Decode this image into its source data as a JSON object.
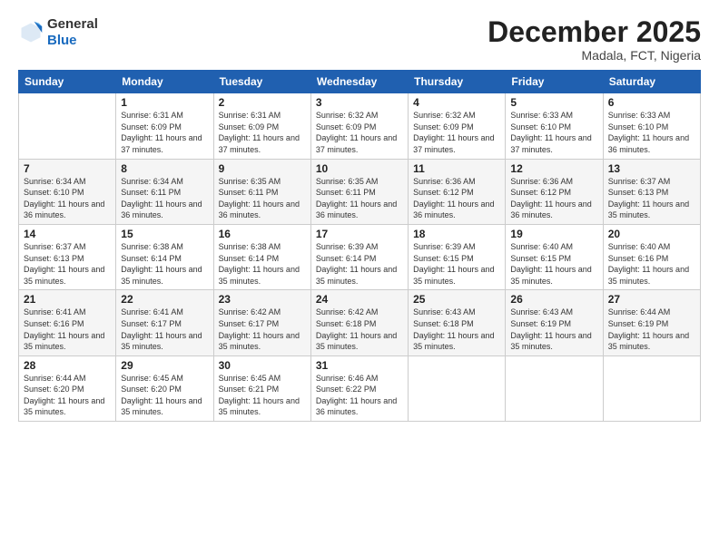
{
  "header": {
    "logo_general": "General",
    "logo_blue": "Blue",
    "month_title": "December 2025",
    "location": "Madala, FCT, Nigeria"
  },
  "weekdays": [
    "Sunday",
    "Monday",
    "Tuesday",
    "Wednesday",
    "Thursday",
    "Friday",
    "Saturday"
  ],
  "weeks": [
    [
      {
        "day": "",
        "sunrise": "",
        "sunset": "",
        "daylight": ""
      },
      {
        "day": "1",
        "sunrise": "Sunrise: 6:31 AM",
        "sunset": "Sunset: 6:09 PM",
        "daylight": "Daylight: 11 hours and 37 minutes."
      },
      {
        "day": "2",
        "sunrise": "Sunrise: 6:31 AM",
        "sunset": "Sunset: 6:09 PM",
        "daylight": "Daylight: 11 hours and 37 minutes."
      },
      {
        "day": "3",
        "sunrise": "Sunrise: 6:32 AM",
        "sunset": "Sunset: 6:09 PM",
        "daylight": "Daylight: 11 hours and 37 minutes."
      },
      {
        "day": "4",
        "sunrise": "Sunrise: 6:32 AM",
        "sunset": "Sunset: 6:09 PM",
        "daylight": "Daylight: 11 hours and 37 minutes."
      },
      {
        "day": "5",
        "sunrise": "Sunrise: 6:33 AM",
        "sunset": "Sunset: 6:10 PM",
        "daylight": "Daylight: 11 hours and 37 minutes."
      },
      {
        "day": "6",
        "sunrise": "Sunrise: 6:33 AM",
        "sunset": "Sunset: 6:10 PM",
        "daylight": "Daylight: 11 hours and 36 minutes."
      }
    ],
    [
      {
        "day": "7",
        "sunrise": "Sunrise: 6:34 AM",
        "sunset": "Sunset: 6:10 PM",
        "daylight": "Daylight: 11 hours and 36 minutes."
      },
      {
        "day": "8",
        "sunrise": "Sunrise: 6:34 AM",
        "sunset": "Sunset: 6:11 PM",
        "daylight": "Daylight: 11 hours and 36 minutes."
      },
      {
        "day": "9",
        "sunrise": "Sunrise: 6:35 AM",
        "sunset": "Sunset: 6:11 PM",
        "daylight": "Daylight: 11 hours and 36 minutes."
      },
      {
        "day": "10",
        "sunrise": "Sunrise: 6:35 AM",
        "sunset": "Sunset: 6:11 PM",
        "daylight": "Daylight: 11 hours and 36 minutes."
      },
      {
        "day": "11",
        "sunrise": "Sunrise: 6:36 AM",
        "sunset": "Sunset: 6:12 PM",
        "daylight": "Daylight: 11 hours and 36 minutes."
      },
      {
        "day": "12",
        "sunrise": "Sunrise: 6:36 AM",
        "sunset": "Sunset: 6:12 PM",
        "daylight": "Daylight: 11 hours and 36 minutes."
      },
      {
        "day": "13",
        "sunrise": "Sunrise: 6:37 AM",
        "sunset": "Sunset: 6:13 PM",
        "daylight": "Daylight: 11 hours and 35 minutes."
      }
    ],
    [
      {
        "day": "14",
        "sunrise": "Sunrise: 6:37 AM",
        "sunset": "Sunset: 6:13 PM",
        "daylight": "Daylight: 11 hours and 35 minutes."
      },
      {
        "day": "15",
        "sunrise": "Sunrise: 6:38 AM",
        "sunset": "Sunset: 6:14 PM",
        "daylight": "Daylight: 11 hours and 35 minutes."
      },
      {
        "day": "16",
        "sunrise": "Sunrise: 6:38 AM",
        "sunset": "Sunset: 6:14 PM",
        "daylight": "Daylight: 11 hours and 35 minutes."
      },
      {
        "day": "17",
        "sunrise": "Sunrise: 6:39 AM",
        "sunset": "Sunset: 6:14 PM",
        "daylight": "Daylight: 11 hours and 35 minutes."
      },
      {
        "day": "18",
        "sunrise": "Sunrise: 6:39 AM",
        "sunset": "Sunset: 6:15 PM",
        "daylight": "Daylight: 11 hours and 35 minutes."
      },
      {
        "day": "19",
        "sunrise": "Sunrise: 6:40 AM",
        "sunset": "Sunset: 6:15 PM",
        "daylight": "Daylight: 11 hours and 35 minutes."
      },
      {
        "day": "20",
        "sunrise": "Sunrise: 6:40 AM",
        "sunset": "Sunset: 6:16 PM",
        "daylight": "Daylight: 11 hours and 35 minutes."
      }
    ],
    [
      {
        "day": "21",
        "sunrise": "Sunrise: 6:41 AM",
        "sunset": "Sunset: 6:16 PM",
        "daylight": "Daylight: 11 hours and 35 minutes."
      },
      {
        "day": "22",
        "sunrise": "Sunrise: 6:41 AM",
        "sunset": "Sunset: 6:17 PM",
        "daylight": "Daylight: 11 hours and 35 minutes."
      },
      {
        "day": "23",
        "sunrise": "Sunrise: 6:42 AM",
        "sunset": "Sunset: 6:17 PM",
        "daylight": "Daylight: 11 hours and 35 minutes."
      },
      {
        "day": "24",
        "sunrise": "Sunrise: 6:42 AM",
        "sunset": "Sunset: 6:18 PM",
        "daylight": "Daylight: 11 hours and 35 minutes."
      },
      {
        "day": "25",
        "sunrise": "Sunrise: 6:43 AM",
        "sunset": "Sunset: 6:18 PM",
        "daylight": "Daylight: 11 hours and 35 minutes."
      },
      {
        "day": "26",
        "sunrise": "Sunrise: 6:43 AM",
        "sunset": "Sunset: 6:19 PM",
        "daylight": "Daylight: 11 hours and 35 minutes."
      },
      {
        "day": "27",
        "sunrise": "Sunrise: 6:44 AM",
        "sunset": "Sunset: 6:19 PM",
        "daylight": "Daylight: 11 hours and 35 minutes."
      }
    ],
    [
      {
        "day": "28",
        "sunrise": "Sunrise: 6:44 AM",
        "sunset": "Sunset: 6:20 PM",
        "daylight": "Daylight: 11 hours and 35 minutes."
      },
      {
        "day": "29",
        "sunrise": "Sunrise: 6:45 AM",
        "sunset": "Sunset: 6:20 PM",
        "daylight": "Daylight: 11 hours and 35 minutes."
      },
      {
        "day": "30",
        "sunrise": "Sunrise: 6:45 AM",
        "sunset": "Sunset: 6:21 PM",
        "daylight": "Daylight: 11 hours and 35 minutes."
      },
      {
        "day": "31",
        "sunrise": "Sunrise: 6:46 AM",
        "sunset": "Sunset: 6:22 PM",
        "daylight": "Daylight: 11 hours and 36 minutes."
      },
      {
        "day": "",
        "sunrise": "",
        "sunset": "",
        "daylight": ""
      },
      {
        "day": "",
        "sunrise": "",
        "sunset": "",
        "daylight": ""
      },
      {
        "day": "",
        "sunrise": "",
        "sunset": "",
        "daylight": ""
      }
    ]
  ]
}
